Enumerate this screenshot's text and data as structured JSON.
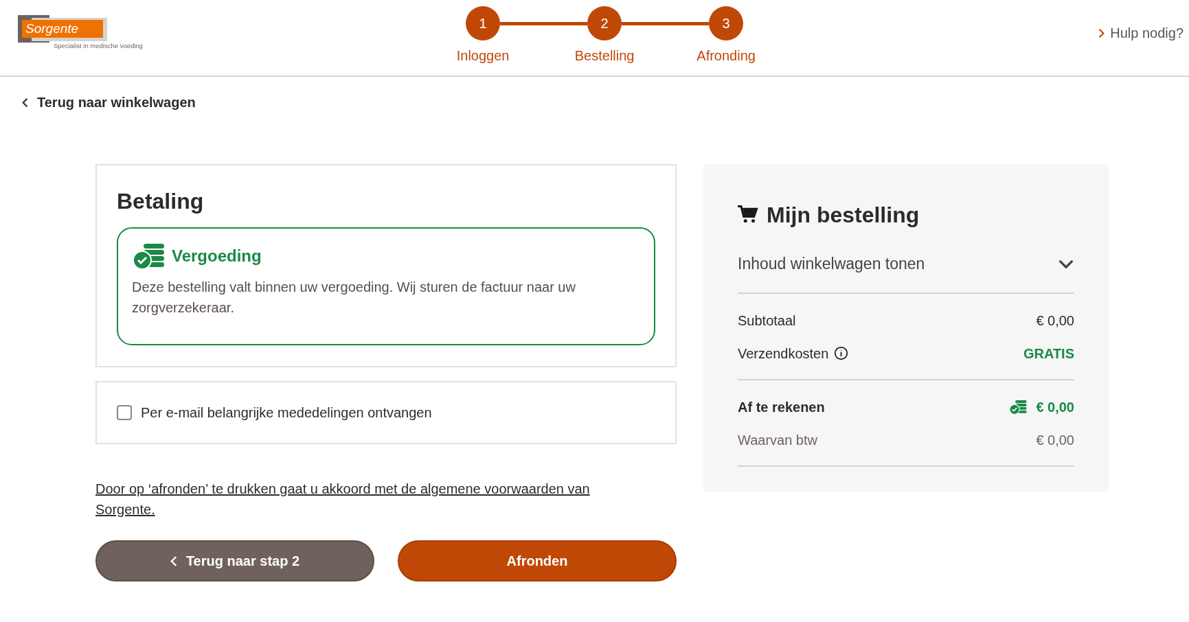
{
  "header": {
    "logo": {
      "name": "Sorgente",
      "tagline": "Specialist in medische voeding"
    },
    "steps": [
      {
        "number": "1",
        "label": "Inloggen"
      },
      {
        "number": "2",
        "label": "Bestelling"
      },
      {
        "number": "3",
        "label": "Afronding"
      }
    ],
    "help_link": "Hulp nodig?"
  },
  "back_link": "Terug naar winkelwagen",
  "payment": {
    "title": "Betaling",
    "notice": {
      "title": "Vergoeding",
      "text": "Deze bestelling valt binnen uw vergoeding. Wij sturen de factuur naar uw zorgverzekeraar."
    }
  },
  "email_option": {
    "label": "Per e-mail belangrijke mededelingen ontvangen",
    "checked": false
  },
  "terms": "Door op ‘afronden’ te drukken gaat u akkoord met de algemene voorwaarden van Sorgente.",
  "buttons": {
    "back": "Terug naar stap 2",
    "finish": "Afronden"
  },
  "order": {
    "title": "Mijn bestelling",
    "toggle": {
      "label": "Inhoud winkelwagen tonen",
      "expanded": false
    },
    "rows": [
      {
        "kind": "plain",
        "label": "Subtotaal",
        "value": "€ 0,00"
      },
      {
        "kind": "shipping",
        "label": "Verzendkosten",
        "value": "GRATIS"
      },
      {
        "kind": "total",
        "label": "Af te rekenen",
        "value": "€ 0,00"
      },
      {
        "kind": "tax",
        "label": "Waarvan btw",
        "value": "€ 0,00"
      }
    ]
  }
}
